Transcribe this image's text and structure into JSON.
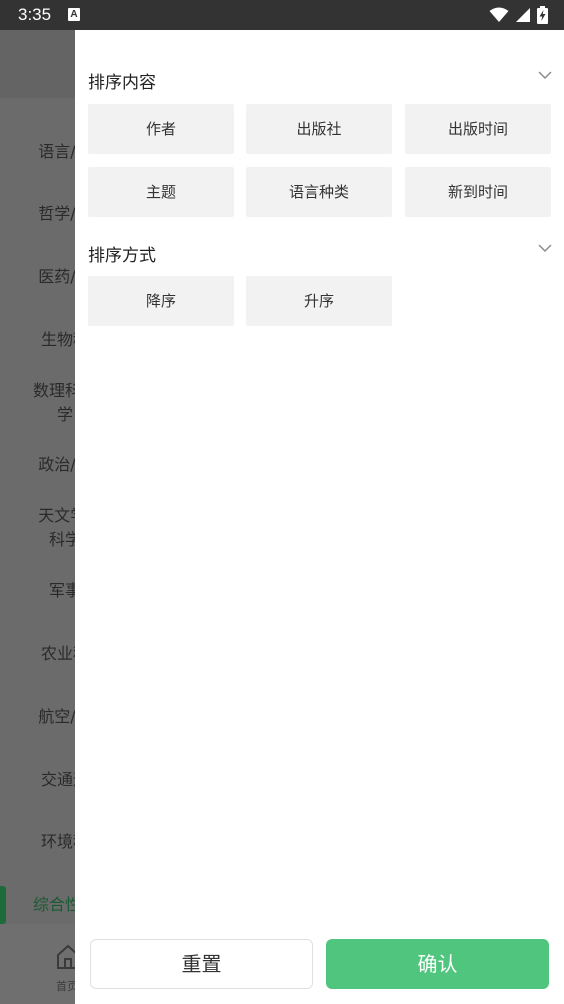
{
  "status_bar": {
    "time": "3:35",
    "notification_badge": "A",
    "icons": [
      "wifi-icon",
      "signal-icon",
      "battery-charging-icon"
    ]
  },
  "background": {
    "categories": [
      {
        "label_line1": "语言/文",
        "label_line2": ""
      },
      {
        "label_line1": "哲学/宗",
        "label_line2": ""
      },
      {
        "label_line1": "医药/卫",
        "label_line2": ""
      },
      {
        "label_line1": "生物科",
        "label_line2": ""
      },
      {
        "label_line1": "数理科学",
        "label_line2": "学"
      },
      {
        "label_line1": "政治/法",
        "label_line2": ""
      },
      {
        "label_line1": "天文学/",
        "label_line2": "科学"
      },
      {
        "label_line1": "军事",
        "label_line2": ""
      },
      {
        "label_line1": "农业科",
        "label_line2": ""
      },
      {
        "label_line1": "航空/航",
        "label_line2": ""
      },
      {
        "label_line1": "交通运",
        "label_line2": ""
      },
      {
        "label_line1": "环境科",
        "label_line2": ""
      }
    ],
    "active_category": "综合性图",
    "bottom_nav_label": "首页",
    "accent_color": "#1d6b3a"
  },
  "drawer": {
    "sort_content": {
      "title": "排序内容",
      "options": [
        "作者",
        "出版社",
        "出版时间",
        "主题",
        "语言种类",
        "新到时间"
      ]
    },
    "sort_order": {
      "title": "排序方式",
      "options": [
        "降序",
        "升序"
      ]
    },
    "reset_label": "重置",
    "confirm_label": "确认",
    "confirm_color": "#4fc57d"
  }
}
